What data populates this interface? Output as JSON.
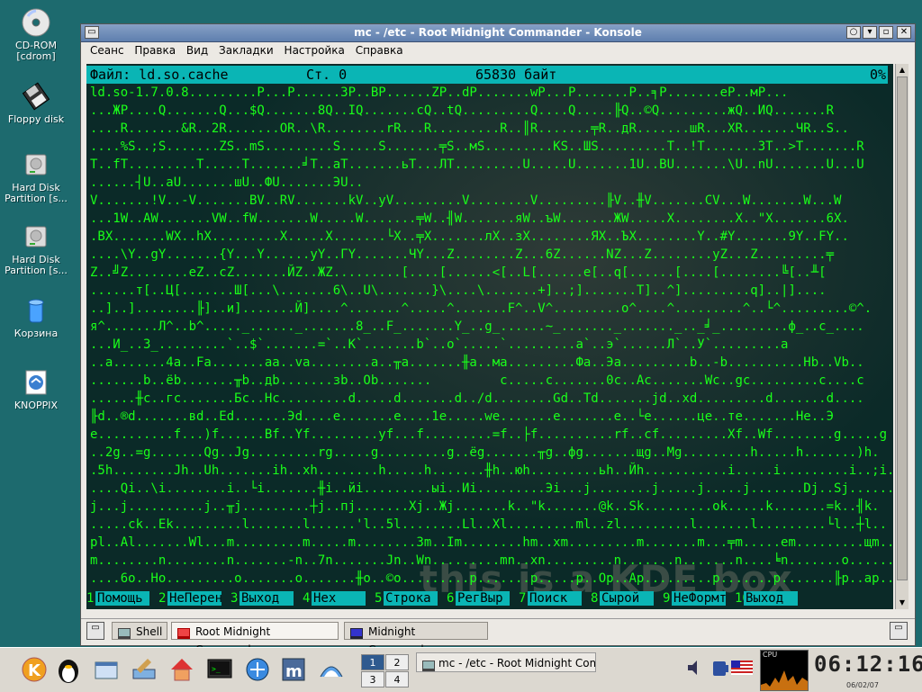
{
  "desktop": {
    "icons": [
      {
        "label": "CD-ROM\n[cdrom]",
        "name": "cdrom-icon"
      },
      {
        "label": "Floppy disk",
        "name": "floppy-icon"
      },
      {
        "label": "Hard Disk\nPartition [s...",
        "name": "harddisk-icon"
      },
      {
        "label": "Hard Disk\nPartition [s...",
        "name": "harddisk-icon"
      },
      {
        "label": "Корзина",
        "name": "trash-icon"
      },
      {
        "label": "KNOPPIX",
        "name": "knoppix-icon"
      }
    ]
  },
  "window": {
    "title": "mc - /etc - Root Midnight Commander - Konsole",
    "menu": [
      "Сеанс",
      "Правка",
      "Вид",
      "Закладки",
      "Настройка",
      "Справка"
    ]
  },
  "viewer": {
    "file_label": "Файл: ld.so.cache",
    "col_label": "Ст. 0",
    "size_label": "65830 байт",
    "percent": "0%",
    "lines": [
      "ld.so-1.7.0.8.........P...P......3P..BP......ZP..dP.......wP...P.......P..╕P.......eP..мP...",
      "...ЖP....Q.......Q...$Q.......8Q..IQ.......cQ..tQ.........Q....Q.....╟Q..©Q.........жQ..ИQ.......R",
      "....R.......&R..2R.......OR..\\R........rR...R.........R..║R.......╤R..дR.......шR...XR.......ЧR..S..",
      "....%S..;S.......ZS..mS.........S.....S.......╤S..мS.........KS..ШS.........T..!T.......3T..>T.......R",
      "T..fT.........T.....T.......╛T..aT.......ьT...ЛT.........U.....U.......1U..BU.......\\U..nU.......U...U",
      "......┤U..aU.......шU..ФU.......ЭU..",
      "V.......!V..-V.......BV..RV.......kV..yV.........V........V.........╟V..╫V.......CV...W.......W...W",
      "...1W..AW.......VW..fW.......W.....W.......╤W..╢W.......яW..ъW.......ЖW.....X........X..\"X.......6X.",
      ".BX.......WX..hX.........X.....X.......└X..╤X.......лX..зX........ЯX..ЪX........Y..#Y.......9Y..FY..",
      "....\\Y..gY.......{Y...Y......yY..ГY.......ЧY...Z........Z...6Z......NZ...Z........yZ...Z.........╤",
      "Z..╝Z........eZ..cZ.......ЙZ..ЖZ.........[....[......<[..L[......e[..q[......[....[........╚[..╨[",
      "......т[..Ц[.......Ш[...\\.......6\\..U\\.......}\\....\\.......+]..;].......T]..^].........q]..|]....",
      "..]..]........╟]..и].......Й]....^.......^.....^.......F^..V^.........o^....^.........^..└^.........©^.",
      "я^.......Л^..b^....._......_.......8_..F_.......Y_..g_......~_......._......._.._╛_.........ф_..c_....",
      "...И_..3_.........`..$`.......=`..К`.......b`..o`.....`.........a`..э`......Л`..У`.........a",
      "..a.......4a..Fa.......aa..va........a..╥a.......╫a..ма.........Фa..Эa.........b..-b..........Hb..Vb..",
      ".......b..ёb.......╥b..дb.......зb..Ob.......         c.....c.......0c..Ac.......Wc..gc.........c....c",
      "......╫c..гc.......Бc..Hc.........d.....d.......d../d........Gd..Td.......jd..xd.........d.......d....",
      "╟d..®d.......вd..Ed.......Эd....e.......e....1e.....we.......e.......e..└e......це..те.......He..Э",
      "e..........f...)f......Bf..Yf.........yf...f.........=f..├f..........rf..cf.........Xf..Wf........g.....g",
      "..2g..=g.......Qg..Jg.........rg.....g.........g..ёg.......╥g..фg.......щg..Mg.........h.....h.......)h.",
      ".5h........Jh..Uh.......ih..xh........h.....h.......╫h..юh.........ьh..Йh...........i.....i.........i..;i..",
      "....Qi..\\i........i..└i.......╫i..йi.........ыi..Иi.........Эi...j........j.....j.....j.......Dj..Sj.......k",
      "j...j..........j..╥j.........┼j..пj.......Xj..Жj.......k..\"k.......@k..Sk.........ok.....k.......=k..╢k.",
      ".....ck..Ek.........l.......l......'l..5l........Ll..Xl.........ml..zl.........l.......l.........└l..┼l..",
      "pl..Al.......Wl...m.........m.....m........3m..Im........hm..xm.........m.......m...╤m.....em.........щm..П",
      "m........n........n.......-n..7n.......Jn..Wn.........mn..xn.........n.......n.......n....╘n.......o........o....",
      "....6o..Ho.........o.......o.......╫o..©o.........p.......p.....p..Op..Ap.........p.......p.......╟p..ap..........q."
    ],
    "fkeys": [
      {
        "n": "1",
        "label": "Помощь"
      },
      {
        "n": "2",
        "label": "НеПерен"
      },
      {
        "n": "3",
        "label": "Выход"
      },
      {
        "n": "4",
        "label": "Hex"
      },
      {
        "n": "5",
        "label": "Строка"
      },
      {
        "n": "6",
        "label": "РегВыр"
      },
      {
        "n": "7",
        "label": "Поиск"
      },
      {
        "n": "8",
        "label": "Сырой"
      },
      {
        "n": "9",
        "label": "НеФормт"
      },
      {
        "n": "10",
        "label": "Выход"
      }
    ]
  },
  "watermark": "this is a KDE box",
  "tabs": [
    {
      "label": "Shell",
      "active": false
    },
    {
      "label": "Root Midnight Commander",
      "active": true
    },
    {
      "label": "Midnight Commander",
      "active": false
    }
  ],
  "taskbar": {
    "pager": [
      "1",
      "2",
      "3",
      "4"
    ],
    "active_desktop": "1",
    "task_label": "mc - /etc - Root Midnight Commander",
    "cpu_label": "CPU",
    "clock": "06:12:16",
    "date": "06/02/07"
  }
}
